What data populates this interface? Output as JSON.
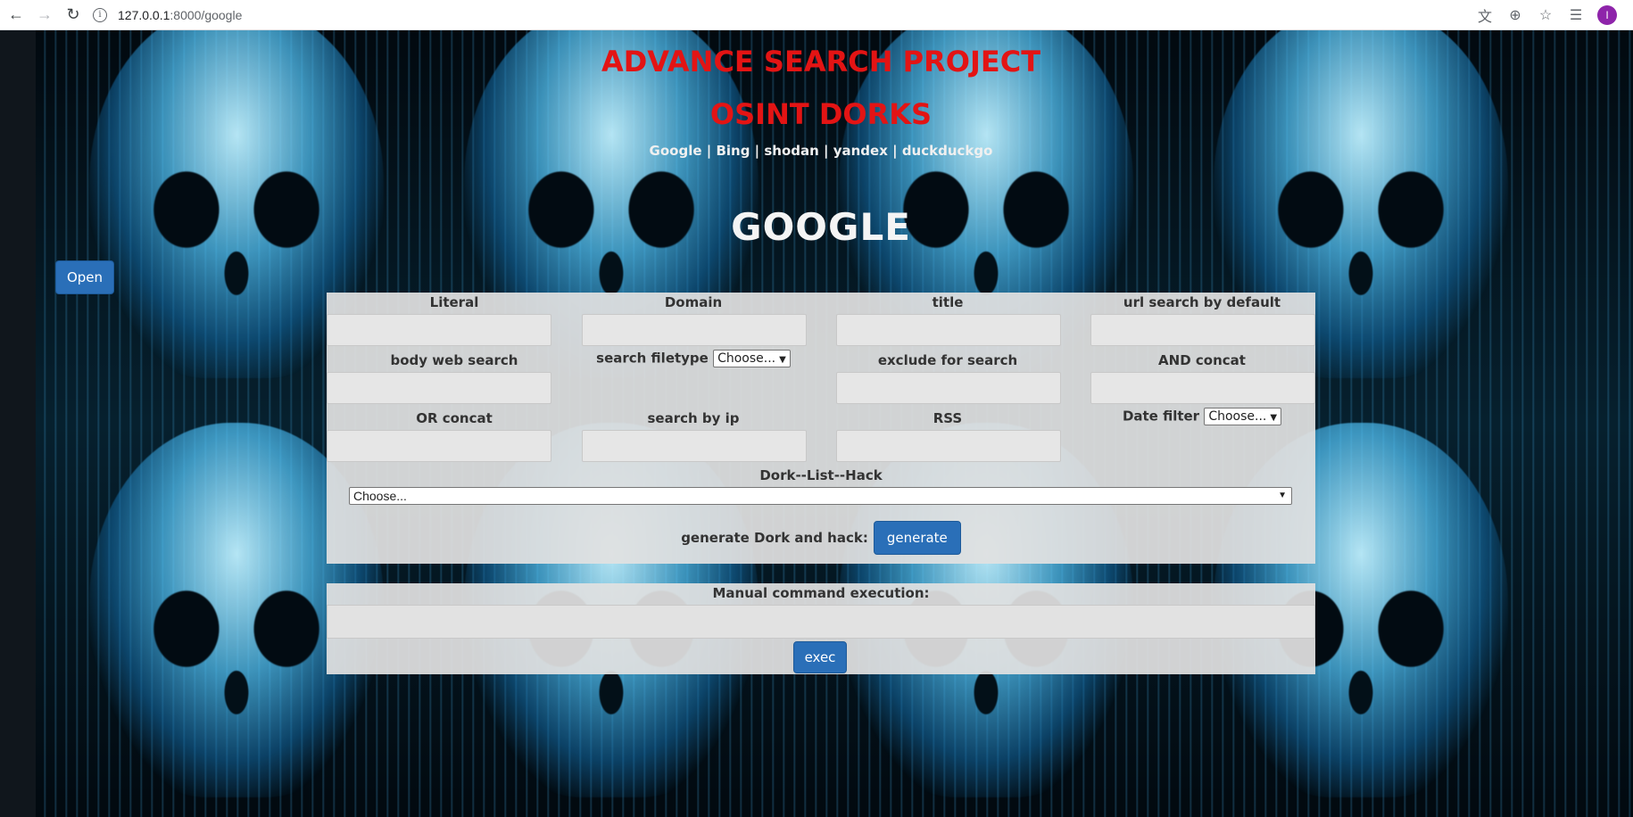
{
  "browser": {
    "url_host": "127.0.0.1",
    "url_rest": ":8000/google",
    "avatar_letter": "I"
  },
  "page": {
    "title": "ADVANCE SEARCH PROJECT",
    "subtitle": "OSINT DORKS",
    "engines": "Google | Bing | shodan | yandex | duckduckgo",
    "engine_title": "GOOGLE",
    "open_button": "Open"
  },
  "form": {
    "fields": {
      "literal": "Literal",
      "domain": "Domain",
      "title": "title",
      "url_search": "url search by default",
      "body_search": "body web search",
      "filetype": "search filetype",
      "exclude": "exclude for search",
      "and_concat": "AND concat",
      "or_concat": "OR concat",
      "search_ip": "search by ip",
      "rss": "RSS",
      "date_filter": "Date filter"
    },
    "filetype_selected": "Choose...",
    "date_selected": "Choose...",
    "dork_label": "Dork--List--Hack",
    "dork_selected": "Choose...",
    "generate_label": "generate Dork and hack:",
    "generate_button": "generate"
  },
  "manual": {
    "label": "Manual command execution:",
    "exec_button": "exec"
  },
  "colors": {
    "title_red": "#e31414",
    "button_blue": "#2a6fb8"
  }
}
